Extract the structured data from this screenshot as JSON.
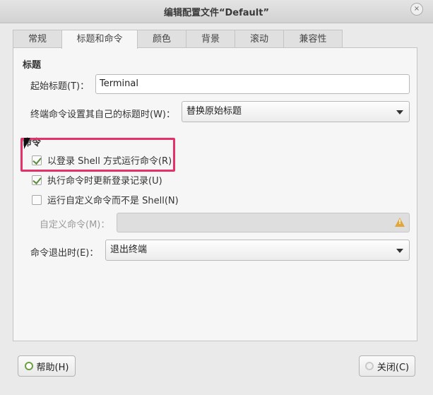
{
  "window": {
    "title": "编辑配置文件“Default”",
    "close_glyph": "×"
  },
  "tabs": [
    {
      "label": "常规"
    },
    {
      "label": "标题和命令"
    },
    {
      "label": "颜色"
    },
    {
      "label": "背景"
    },
    {
      "label": "滚动"
    },
    {
      "label": "兼容性"
    }
  ],
  "title_section": {
    "heading": "标题",
    "initial_title_label": "起始标题(T)：",
    "initial_title_value": "Terminal",
    "dynamic_title_label": "终端命令设置其自己的标题时(W)：",
    "dynamic_title_value": "替换原始标题"
  },
  "command_section": {
    "heading": "命令",
    "login_shell_label": "以登录 Shell 方式运行命令(R)",
    "login_shell_checked": true,
    "update_records_label": "执行命令时更新登录记录(U)",
    "update_records_checked": true,
    "custom_command_label": "运行自定义命令而不是 Shell(N)",
    "custom_command_checked": false,
    "custom_command_field_label": "自定义命令(M)：",
    "custom_command_value": "",
    "exit_label": "命令退出时(E)：",
    "exit_value": "退出终端"
  },
  "footer": {
    "help_label": "帮助(H)",
    "close_label": "关闭(C)"
  },
  "colors": {
    "highlight": "#e5316a",
    "check": "#5b8c3a"
  }
}
